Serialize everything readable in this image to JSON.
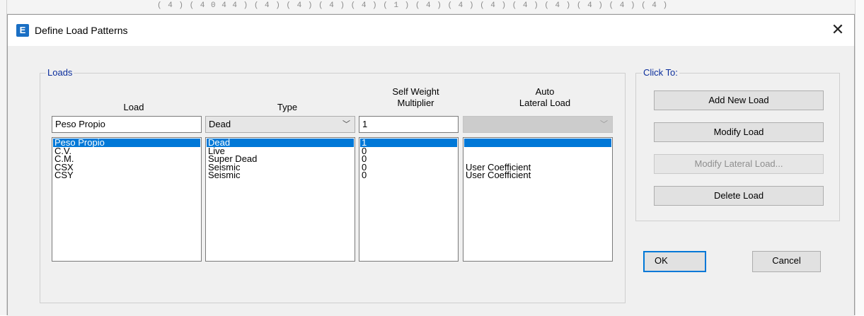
{
  "background": {
    "ruler_marks": "( 4 )   ( 4 0 4 4 )      ( 4 )          ( 4 )   ( 4 )    ( 4 )   ( 1 )  ( 4 )   ( 4 ) ( 4 )       ( 4 )   ( 4 )          ( 4 )    ( 4 ) ( 4 )"
  },
  "window": {
    "icon_letter": "E",
    "title": "Define Load Patterns",
    "close_glyph": "✕"
  },
  "loads_group": {
    "legend": "Loads",
    "headers": {
      "load": "Load",
      "type": "Type",
      "self_weight": "Self Weight\nMultiplier",
      "auto_lateral": "Auto\nLateral Load"
    },
    "edit_row": {
      "load_value": "Peso Propio",
      "type_value": "Dead",
      "multiplier_value": "1",
      "auto_lateral_value": ""
    },
    "rows": [
      {
        "load": "Peso Propio",
        "type": "Dead",
        "multiplier": "1",
        "auto_lateral": ""
      },
      {
        "load": "C.V.",
        "type": "Live",
        "multiplier": "0",
        "auto_lateral": ""
      },
      {
        "load": "C.M.",
        "type": "Super Dead",
        "multiplier": "0",
        "auto_lateral": ""
      },
      {
        "load": "CSX",
        "type": "Seismic",
        "multiplier": "0",
        "auto_lateral": "User Coefficient"
      },
      {
        "load": "CSY",
        "type": "Seismic",
        "multiplier": "0",
        "auto_lateral": "User Coefficient"
      }
    ],
    "selected_index": 0
  },
  "click_to_group": {
    "legend": "Click To:",
    "add_new_load": "Add New Load",
    "modify_load": "Modify Load",
    "modify_lateral_load": "Modify Lateral Load...",
    "delete_load": "Delete Load"
  },
  "footer": {
    "ok": "OK",
    "cancel": "Cancel"
  },
  "icons": {
    "combo_arrow": "chevron-down-icon",
    "close": "close-icon"
  }
}
